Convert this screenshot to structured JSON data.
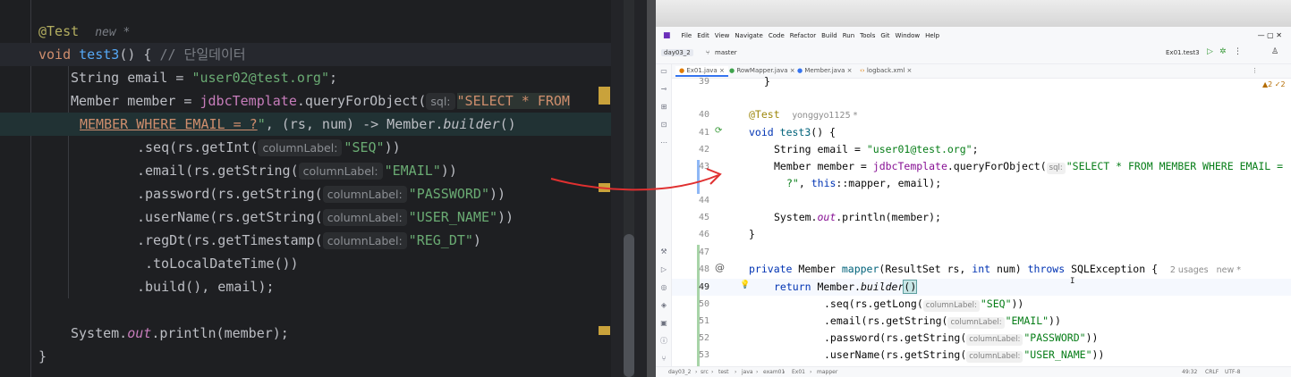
{
  "left_editor": {
    "lines": [
      {
        "annotation": "@Test",
        "gray": "new *"
      },
      {
        "kw": "void",
        "name": "test3",
        "rest": "() { ",
        "comment": "// 단일데이터"
      },
      {
        "text1": "String email = ",
        "str": "\"user02@test.org\"",
        "text2": ";"
      },
      {
        "text1": "Member member = ",
        "fn": "jdbcTemplate",
        "text2": ".queryForObject(",
        "hint": "sql:",
        "str": "\"SELECT * FROM"
      },
      {
        "sql": "MEMBER WHERE EMAIL = ?",
        "str": "\"",
        "text2": ", (rs, num) -> Member.",
        "ital": "builder",
        "text3": "()"
      },
      {
        "text1": ".seq(rs.getInt(",
        "hint": "columnLabel:",
        "str": "\"SEQ\"",
        "text2": "))"
      },
      {
        "text1": ".email(rs.getString(",
        "hint": "columnLabel:",
        "str": "\"EMAIL\"",
        "text2": "))"
      },
      {
        "text1": ".password(rs.getString(",
        "hint": "columnLabel:",
        "str": "\"PASSWORD\"",
        "text2": "))"
      },
      {
        "text1": ".userName(rs.getString(",
        "hint": "columnLabel:",
        "str": "\"USER_NAME\"",
        "text2": "))"
      },
      {
        "text1": ".regDt(rs.getTimestamp(",
        "hint": "columnLabel:",
        "str": "\"REG_DT\"",
        "text2": ")"
      },
      {
        "text1": ".toLocalDateTime())"
      },
      {
        "text1": ".build(), email);"
      },
      {
        "text1": ""
      },
      {
        "text1": "System.",
        "ital": "out",
        "text2": ".println(member);"
      },
      {
        "text1": "}"
      }
    ]
  },
  "right_ide": {
    "menu": [
      "File",
      "Edit",
      "View",
      "Navigate",
      "Code",
      "Refactor",
      "Build",
      "Run",
      "Tools",
      "Git",
      "Window",
      "Help"
    ],
    "project": "day03_2",
    "branch": "master",
    "run_config": "Ex01.test3",
    "tabs": [
      "Ex01.java",
      "RowMapper.java",
      "Member.java",
      "logback.xml"
    ],
    "warnings": "▲2 ✓2",
    "line_numbers": [
      "39",
      "40",
      "41",
      "42",
      "43",
      "",
      "44",
      "45",
      "46",
      "47",
      "48",
      "49",
      "50",
      "51",
      "52",
      "53"
    ],
    "code": {
      "l39": "}",
      "l40_ann": "@Test",
      "l40_author": "yonggyo1125 *",
      "l41_kw": "void",
      "l41_name": "test3",
      "l41_rest": "() {",
      "l42_text": "String email = ",
      "l42_str": "\"user01@test.org\"",
      "l42_end": ";",
      "l43_text": "Member member = ",
      "l43_fn": "jdbcTemplate",
      "l43_call": ".queryForObject(",
      "l43_hint": "sql:",
      "l43_str": "\"SELECT * FROM MEMBER WHERE EMAIL =",
      "l43b_str": "?\"",
      "l43b_kw": "this",
      "l43b_rest": "::mapper, email);",
      "l45_a": "System.",
      "l45_it": "out",
      "l45_b": ".println(member);",
      "l46": "}",
      "l48_kw1": "private",
      "l48_t": " Member ",
      "l48_fn": "mapper",
      "l48_p1": "(ResultSet rs, ",
      "l48_kw2": "int",
      "l48_p2": " num) ",
      "l48_kw3": "throws",
      "l48_p3": " SQLException {",
      "l48_gray": "2 usages   new *",
      "l49_kw": "return",
      "l49_t": " Member.",
      "l49_it": "builder",
      "l49_p": "()",
      "l50_a": ".seq(rs.getLong(",
      "l50_h": "columnLabel:",
      "l50_s": "\"SEQ\"",
      "l50_b": "))",
      "l51_a": ".email(rs.getString(",
      "l51_h": "columnLabel:",
      "l51_s": "\"EMAIL\"",
      "l51_b": "))",
      "l52_a": ".password(rs.getString(",
      "l52_h": "columnLabel:",
      "l52_s": "\"PASSWORD\"",
      "l52_b": "))",
      "l53_a": ".userName(rs.getString(",
      "l53_h": "columnLabel:",
      "l53_s": "\"USER_NAME\"",
      "l53_b": "))"
    },
    "status": {
      "path": [
        "day03_2",
        "src",
        "test",
        "java",
        "exam01",
        "Ex01",
        "mapper"
      ],
      "position": "49:32",
      "line_sep": "CRLF",
      "encoding": "UTF-8"
    }
  },
  "colors": {
    "arrow": "#e03030",
    "left_bg": "#1e1f22",
    "right_bg": "#ffffff"
  }
}
